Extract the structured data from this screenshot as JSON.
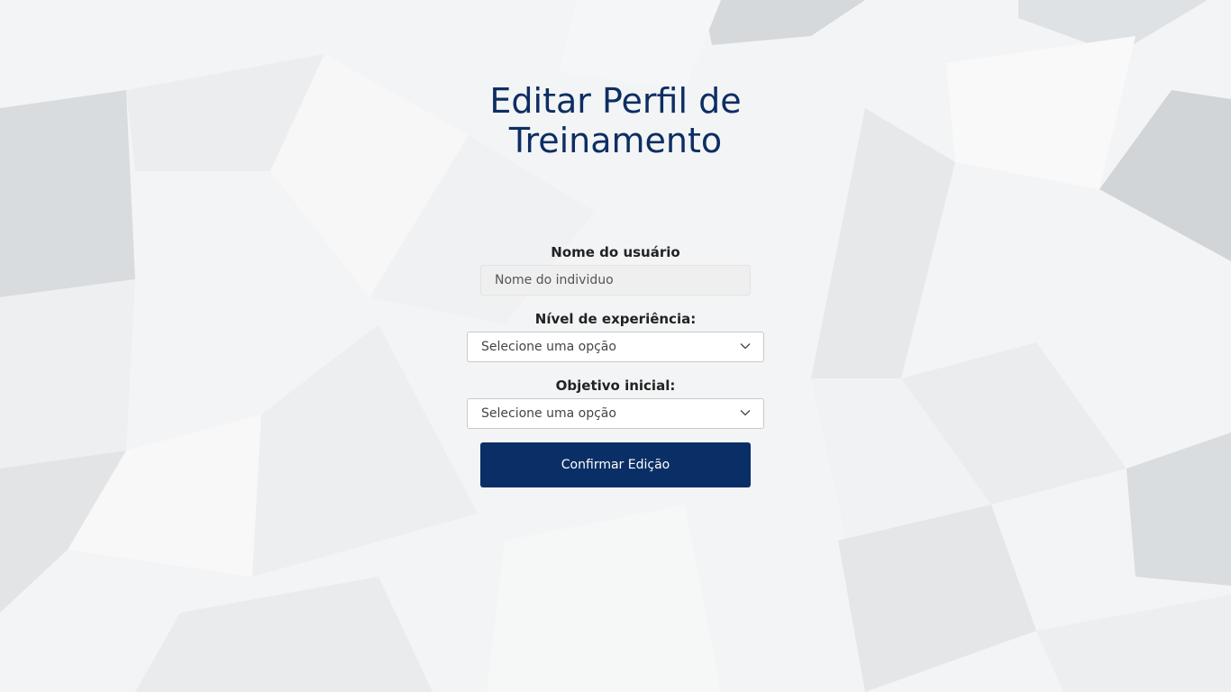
{
  "page": {
    "title": "Editar Perfil de Treinamento"
  },
  "form": {
    "username": {
      "label": "Nome do usuário",
      "placeholder": "Nome do individuo",
      "value": ""
    },
    "experience": {
      "label": "Nível de experiência:",
      "selected": "Selecione uma opção"
    },
    "goal": {
      "label": "Objetivo inicial:",
      "selected": "Selecione uma opção"
    },
    "submit_label": "Confirmar Edição"
  },
  "colors": {
    "title": "#0d2e63",
    "button_bg": "#0a2f66",
    "button_text": "#ffffff"
  },
  "icons": {
    "select_chevron": "chevron-down-icon"
  }
}
